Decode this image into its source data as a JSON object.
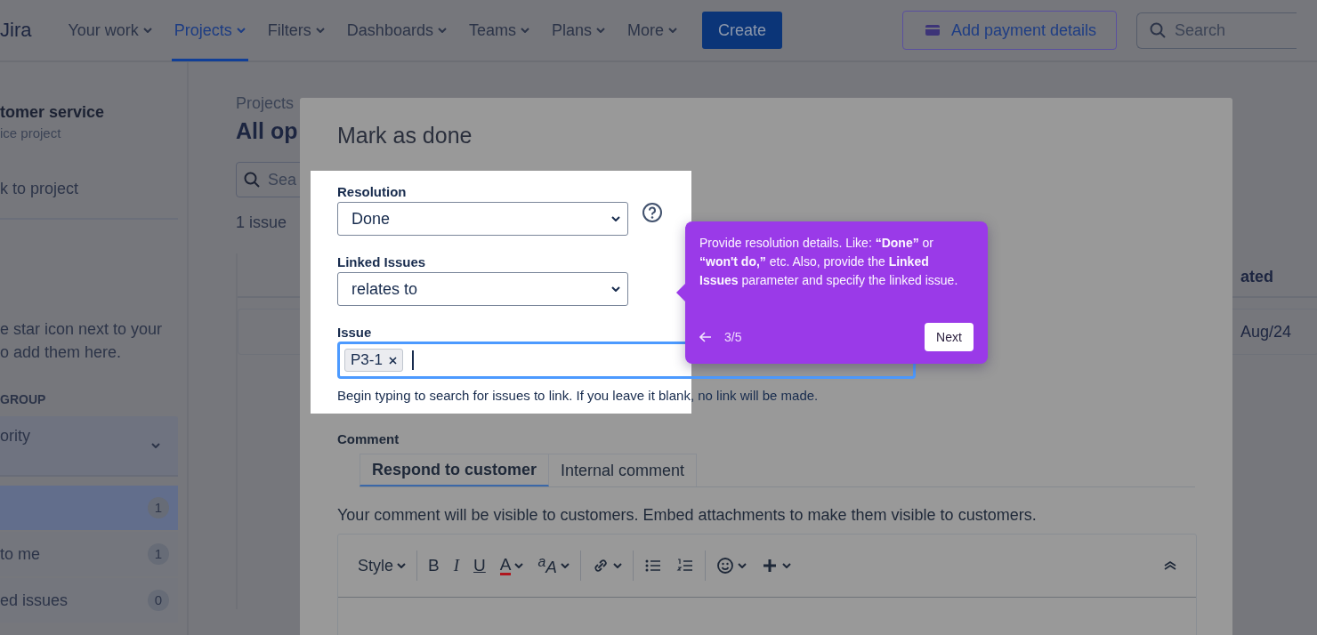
{
  "nav": {
    "logo": "Jira",
    "items": [
      {
        "label": "Your work",
        "selected": false
      },
      {
        "label": "Projects",
        "selected": true
      },
      {
        "label": "Filters",
        "selected": false
      },
      {
        "label": "Dashboards",
        "selected": false
      },
      {
        "label": "Teams",
        "selected": false
      },
      {
        "label": "Plans",
        "selected": false
      },
      {
        "label": "More",
        "selected": false
      }
    ],
    "create": "Create",
    "payment": "Add payment details",
    "search": {
      "placeholder": "Search"
    }
  },
  "sidebar": {
    "project_name": "tomer service",
    "project_type": "ice project",
    "back_link": "k to project",
    "hint_lines": [
      "e star icon next to your",
      "o add them here."
    ],
    "group_heading": "GROUP",
    "group_select": "ority",
    "queues": [
      {
        "count": "1",
        "selected": true
      },
      {
        "label": "to me",
        "count": "1",
        "selected": false
      },
      {
        "label": "ed issues",
        "count": "0",
        "selected": false
      }
    ]
  },
  "main": {
    "breadcrumb": "Projects",
    "title": "All op",
    "search": {
      "placeholder": "Sea"
    },
    "issue_count": "1 issue",
    "table": {
      "columns": [
        "ated"
      ],
      "rows": [
        [
          "Aug/24"
        ]
      ]
    }
  },
  "modal": {
    "title": "Mark as done",
    "fields": [
      {
        "kind": "select",
        "label": "Resolution",
        "value": "Done",
        "help": true
      },
      {
        "kind": "select",
        "label": "Linked Issues",
        "value": "relates to",
        "help": false
      },
      {
        "kind": "tags",
        "label": "Issue",
        "tags": [
          "P3-1"
        ],
        "focused": true,
        "hint": "Begin typing to search for issues to link. If you leave it blank, no link will be made."
      }
    ],
    "comment": {
      "label": "Comment",
      "tabs": [
        {
          "label": "Respond to customer",
          "selected": true
        },
        {
          "label": "Internal comment",
          "selected": false
        }
      ],
      "note": "Your comment will be visible to customers. Embed attachments to make them visible to customers.",
      "toolbar_groups": [
        [
          {
            "kind": "style",
            "text": "Style",
            "caret": true
          }
        ],
        [
          {
            "kind": "bold",
            "text": "B",
            "caret": false
          },
          {
            "kind": "italic",
            "text": "I",
            "caret": false
          },
          {
            "kind": "underline",
            "text": "U",
            "caret": false
          },
          {
            "kind": "color",
            "text": "A",
            "caret": true
          },
          {
            "kind": "size",
            "text": "$^{a}$A",
            "caret": true
          }
        ],
        [
          {
            "kind": "link",
            "caret": true
          }
        ],
        [
          {
            "kind": "bullets",
            "caret": false
          },
          {
            "kind": "numbers",
            "caret": false
          }
        ],
        [
          {
            "kind": "emoji",
            "caret": true
          },
          {
            "kind": "insert",
            "caret": true
          }
        ]
      ]
    }
  },
  "tooltip": {
    "text": "Provide resolution details. Like: **“Done”** or **“won't do,”** etc. Also, provide the **Linked Issues** parameter and specify the linked issue.",
    "step": "3/5",
    "next": "Next"
  }
}
